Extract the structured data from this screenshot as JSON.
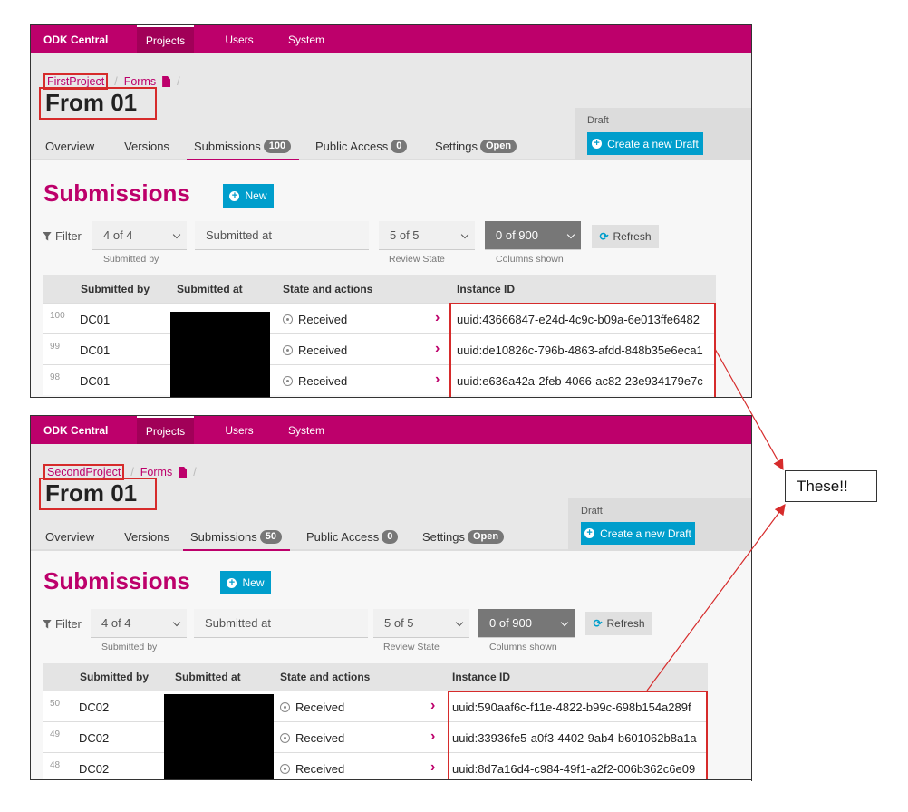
{
  "annotation": {
    "callout_text": "These!!"
  },
  "panels": [
    {
      "nav": {
        "brand": "ODK Central",
        "projects": "Projects",
        "users": "Users",
        "system": "System"
      },
      "breadcrumb": {
        "project": "FirstProject",
        "separator": "/",
        "forms": "Forms"
      },
      "form_title": "From 01",
      "tabs": {
        "overview": "Overview",
        "versions": "Versions",
        "submissions": "Submissions",
        "submissions_count": "100",
        "public_access": "Public Access",
        "public_access_count": "0",
        "settings": "Settings",
        "settings_badge": "Open"
      },
      "draft": {
        "label": "Draft",
        "button": "Create a new Draft"
      },
      "heading": "Submissions",
      "new_button": "New",
      "filters": {
        "label": "Filter",
        "submitted_by_value": "4 of 4",
        "submitted_by_help": "Submitted by",
        "submitted_at_value": "Submitted at",
        "review_state_value": "5 of 5",
        "review_state_help": "Review State",
        "columns_value": "0 of 900",
        "columns_help": "Columns shown",
        "refresh": "Refresh"
      },
      "table": {
        "headers": {
          "submitted_by": "Submitted by",
          "submitted_at": "Submitted at",
          "state": "State and actions",
          "instance_id": "Instance ID"
        },
        "rows": [
          {
            "num": "100",
            "submitted_by": "DC01",
            "state": "Received",
            "instance_id": "uuid:43666847-e24d-4c9c-b09a-6e013ffe6482"
          },
          {
            "num": "99",
            "submitted_by": "DC01",
            "state": "Received",
            "instance_id": "uuid:de10826c-796b-4863-afdd-848b35e6eca1"
          },
          {
            "num": "98",
            "submitted_by": "DC01",
            "state": "Received",
            "instance_id": "uuid:e636a42a-2feb-4066-ac82-23e934179e7c"
          }
        ]
      }
    },
    {
      "nav": {
        "brand": "ODK Central",
        "projects": "Projects",
        "users": "Users",
        "system": "System"
      },
      "breadcrumb": {
        "project": "SecondProject",
        "separator": "/",
        "forms": "Forms"
      },
      "form_title": "From 01",
      "tabs": {
        "overview": "Overview",
        "versions": "Versions",
        "submissions": "Submissions",
        "submissions_count": "50",
        "public_access": "Public Access",
        "public_access_count": "0",
        "settings": "Settings",
        "settings_badge": "Open"
      },
      "draft": {
        "label": "Draft",
        "button": "Create a new Draft"
      },
      "heading": "Submissions",
      "new_button": "New",
      "filters": {
        "label": "Filter",
        "submitted_by_value": "4 of 4",
        "submitted_by_help": "Submitted by",
        "submitted_at_value": "Submitted at",
        "review_state_value": "5 of 5",
        "review_state_help": "Review State",
        "columns_value": "0 of 900",
        "columns_help": "Columns shown",
        "refresh": "Refresh"
      },
      "table": {
        "headers": {
          "submitted_by": "Submitted by",
          "submitted_at": "Submitted at",
          "state": "State and actions",
          "instance_id": "Instance ID"
        },
        "rows": [
          {
            "num": "50",
            "submitted_by": "DC02",
            "state": "Received",
            "instance_id": "uuid:590aaf6c-f11e-4822-b99c-698b154a289f"
          },
          {
            "num": "49",
            "submitted_by": "DC02",
            "state": "Received",
            "instance_id": "uuid:33936fe5-a0f3-4402-9ab4-b601062b8a1a"
          },
          {
            "num": "48",
            "submitted_by": "DC02",
            "state": "Received",
            "instance_id": "uuid:8d7a16d4-c984-49f1-a2f2-006b362c6e09"
          }
        ]
      }
    }
  ]
}
